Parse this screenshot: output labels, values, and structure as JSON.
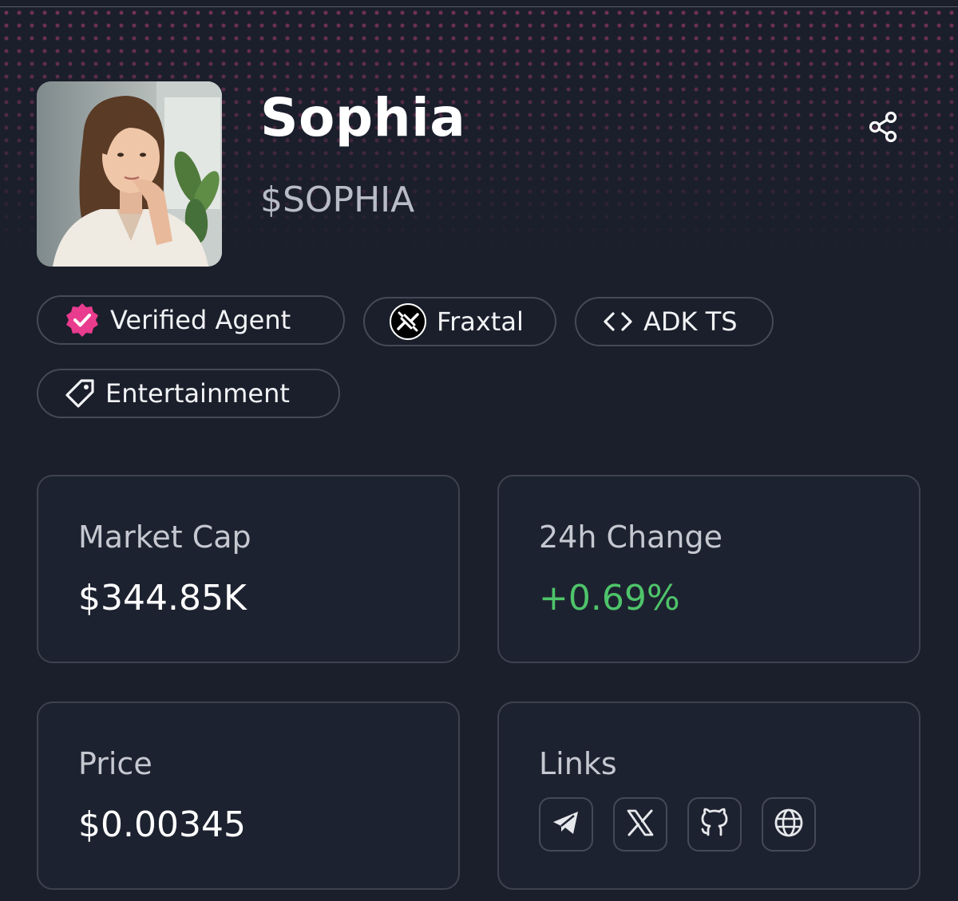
{
  "agent": {
    "name": "Sophia",
    "ticker": "$SOPHIA",
    "avatar_alt": "avatar"
  },
  "actions": {
    "share_icon": "share-icon"
  },
  "tags": [
    {
      "label": "Verified Agent",
      "icon": "verified-badge-icon"
    },
    {
      "label": "Fraxtal",
      "icon": "fraxtal-logo-icon"
    },
    {
      "label": "ADK TS",
      "icon": "code-brackets-icon"
    },
    {
      "label": "Entertainment",
      "icon": "tag-icon"
    }
  ],
  "stats": {
    "market_cap": {
      "label": "Market Cap",
      "value": "$344.85K"
    },
    "change_24h": {
      "label": "24h Change",
      "value": "+0.69%"
    },
    "price": {
      "label": "Price",
      "value": "$0.00345"
    },
    "links": {
      "label": "Links",
      "items": [
        {
          "icon": "telegram-icon"
        },
        {
          "icon": "x-icon"
        },
        {
          "icon": "github-icon"
        },
        {
          "icon": "globe-icon"
        }
      ]
    }
  },
  "colors": {
    "background": "#1b1f2b",
    "accent_pink": "#e93c8e",
    "positive_green": "#4ec46a",
    "card_border": "#3d424e"
  }
}
